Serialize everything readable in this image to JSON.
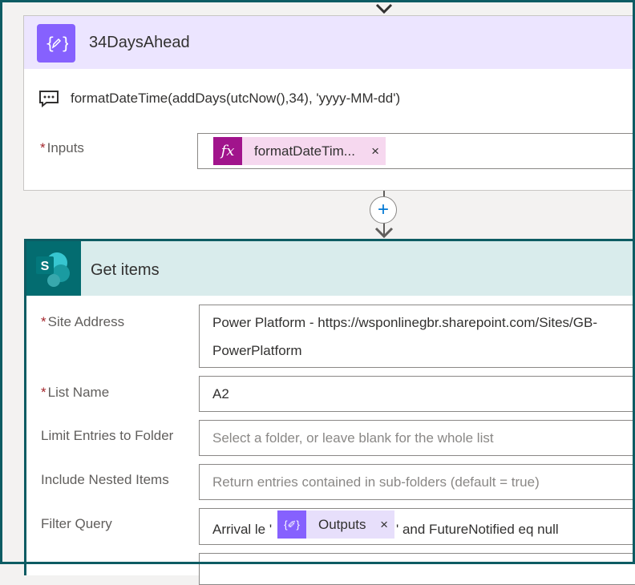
{
  "compose": {
    "title": "34DaysAhead",
    "comment": "formatDateTime(addDays(utcNow(),34), 'yyyy-MM-dd')",
    "inputs_label": "Inputs",
    "required_mark": "*",
    "input_token": "formatDateTim...",
    "token_remove": "×",
    "fx_symbol": "fx",
    "icon": "{✐}"
  },
  "connector": {
    "plus": "+"
  },
  "get_items": {
    "title": "Get items",
    "icon_letter": "S",
    "required_mark": "*",
    "fields": {
      "site_address": {
        "label": "Site Address",
        "value": "Power Platform - https://wsponlinegbr.sharepoint.com/Sites/GB-PowerPlatform"
      },
      "list_name": {
        "label": "List Name",
        "value": "A2"
      },
      "limit_folder": {
        "label": "Limit Entries to Folder",
        "placeholder": "Select a folder, or leave blank for the whole list"
      },
      "nested_items": {
        "label": "Include Nested Items",
        "placeholder": "Return entries contained in sub-folders (default = true)"
      },
      "filter_query": {
        "label": "Filter Query",
        "prefix": "Arrival le '",
        "token": "Outputs",
        "token_icon": "{✐}",
        "token_remove": "×",
        "suffix": "' and FutureNotified eq null"
      }
    }
  },
  "colors": {
    "compose_accent": "#8661fe",
    "compose_header": "#ece5ff",
    "sharepoint_accent": "#036c70",
    "sharepoint_header": "#d9ecec",
    "fx_token": "#a1148c",
    "border_frame": "#0d5c63"
  }
}
